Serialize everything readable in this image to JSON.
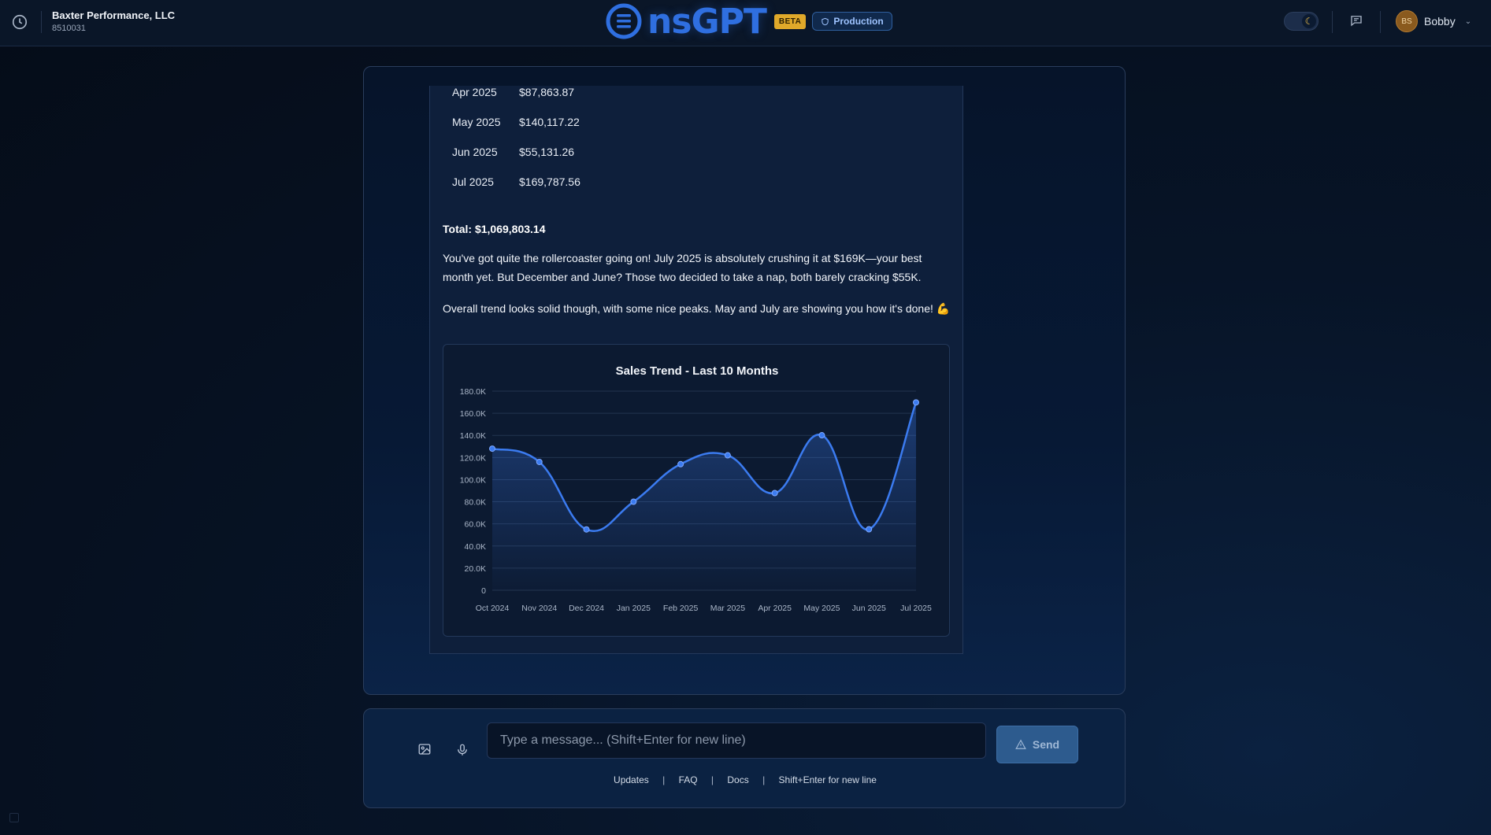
{
  "header": {
    "company_name": "Baxter Performance, LLC",
    "company_id": "8510031",
    "brand": "nsGPT",
    "beta_label": "BETA",
    "env_label": "Production",
    "user_initials": "BS",
    "user_name": "Bobby"
  },
  "message": {
    "rows": [
      {
        "month": "Apr 2025",
        "amount": "$87,863.87"
      },
      {
        "month": "May 2025",
        "amount": "$140,117.22"
      },
      {
        "month": "Jun 2025",
        "amount": "$55,131.26"
      },
      {
        "month": "Jul 2025",
        "amount": "$169,787.56"
      }
    ],
    "total": "Total: $1,069,803.14",
    "paragraph1": "You've got quite the rollercoaster going on! July 2025 is absolutely crushing it at $169K—your best month yet. But December and June? Those two decided to take a nap, both barely cracking $55K.",
    "paragraph2": "Overall trend looks solid though, with some nice peaks. May and July are showing you how it's done! 💪"
  },
  "chart_data": {
    "type": "area",
    "title": "Sales Trend - Last 10 Months",
    "categories": [
      "Oct 2024",
      "Nov 2024",
      "Dec 2024",
      "Jan 2025",
      "Feb 2025",
      "Mar 2025",
      "Apr 2025",
      "May 2025",
      "Jun 2025",
      "Jul 2025"
    ],
    "series": [
      {
        "values": [
          128000,
          116000,
          55000,
          80000,
          114000,
          122000,
          87863.87,
          140117.22,
          55131.26,
          169787.56
        ]
      }
    ],
    "y_ticks": [
      "0",
      "20.0K",
      "40.0K",
      "60.0K",
      "80.0K",
      "100.0K",
      "120.0K",
      "140.0K",
      "160.0K",
      "180.0K"
    ],
    "ylim": [
      0,
      180000
    ],
    "grid": true,
    "line_color": "#3b7bf0"
  },
  "input": {
    "placeholder": "Type a message... (Shift+Enter for new line)",
    "send_label": "Send"
  },
  "footer": {
    "updates": "Updates",
    "faq": "FAQ",
    "docs": "Docs",
    "separator": "|",
    "hint": "Shift+Enter for new line"
  }
}
